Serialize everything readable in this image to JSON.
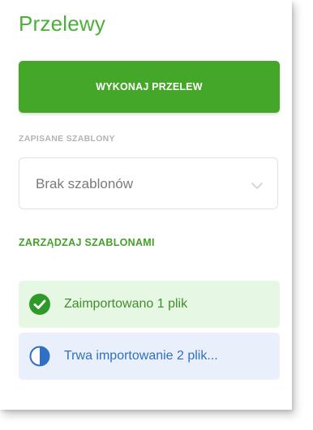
{
  "page": {
    "title": "Przelewy"
  },
  "actions": {
    "primary_label": "WYKONAJ PRZELEW"
  },
  "templates": {
    "section_label": "ZAPISANE SZABLONY",
    "selected_value": "Brak szablonów",
    "manage_label": "ZARZĄDZAJ SZABLONAMI"
  },
  "notifications": [
    {
      "type": "success",
      "icon": "check-circle-icon",
      "text": "Zaimportowano 1 plik"
    },
    {
      "type": "progress",
      "icon": "pie-progress-icon",
      "text": "Trwa importowanie 2 plik..."
    }
  ],
  "colors": {
    "brand_green": "#44a72a",
    "title_green": "#4caf3a",
    "success_bg": "#e6f7e4",
    "progress_bg": "#e9f0fb",
    "progress_blue": "#2f6fc4"
  }
}
